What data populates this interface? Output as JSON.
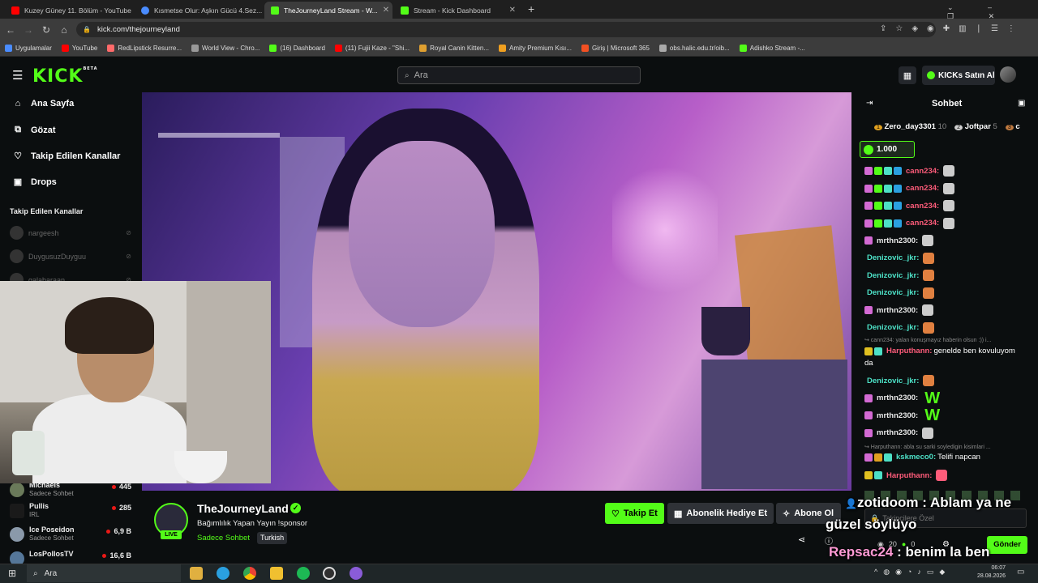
{
  "browser": {
    "tabs": [
      {
        "title": "Kuzey Güney 11. Bölüm - YouTube",
        "color": "#ff0000",
        "active": false
      },
      {
        "title": "Kısmetse Olur: Aşkın Gücü 4.Sez...",
        "color": "#4a8cff",
        "active": false
      },
      {
        "title": "TheJourneyLand Stream - W...",
        "color": "#53fc18",
        "active": true
      },
      {
        "title": "Stream - Kick Dashboard",
        "color": "#53fc18",
        "active": false
      }
    ],
    "new_tab": "+",
    "url": "kick.com/thejourneyland",
    "bookmarks": [
      {
        "label": "Uygulamalar",
        "color": "#4a8cff"
      },
      {
        "label": "YouTube",
        "color": "#ff0000"
      },
      {
        "label": "RedLipstick Resurre...",
        "color": "#ff6a6a"
      },
      {
        "label": "World View - Chro...",
        "color": "#999999"
      },
      {
        "label": "(16) Dashboard",
        "color": "#53fc18"
      },
      {
        "label": "(11) Fujii Kaze - \"Shi...",
        "color": "#ff0000"
      },
      {
        "label": "Royal Canin Kitten...",
        "color": "#e0a030"
      },
      {
        "label": "Amity Premium Kısı...",
        "color": "#f0a020"
      },
      {
        "label": "Giriş | Microsoft 365",
        "color": "#f25022"
      },
      {
        "label": "obs.halic.edu.tr/oib...",
        "color": "#aaaaaa"
      },
      {
        "label": "Adishko Stream -...",
        "color": "#53fc18"
      }
    ]
  },
  "header": {
    "logo": "KICK",
    "logo_sup": "BETA",
    "search_placeholder": "Ara",
    "kicks_button": "KICKs Satın Al",
    "accent": "#53fc18"
  },
  "sidebar": {
    "nav": [
      "Ana Sayfa",
      "Gözat",
      "Takip Edilen Kanallar",
      "Drops"
    ],
    "followed_header": "Takip Edilen Kanallar",
    "followed": [
      "nargeesh",
      "DuygusuzDuyguu",
      "galabaraan"
    ],
    "recommended": [
      {
        "name": "Michaels",
        "category": "Sadece Sohbet",
        "viewers": "445"
      },
      {
        "name": "Pullis",
        "category": "IRL",
        "viewers": "285"
      },
      {
        "name": "Ice Poseidon",
        "category": "Sadece Sohbet",
        "viewers": "6,9 B"
      },
      {
        "name": "LosPollosTV",
        "category": "",
        "viewers": "16,6 B"
      }
    ]
  },
  "channel": {
    "name": "TheJourneyLand",
    "verified": "✓",
    "live": "LIVE",
    "title": "Bağımlılık Yapan Yayın !sponsor",
    "category": "Sadece Sohbet",
    "language": "Turkish",
    "follow": "Takip Et",
    "gift_sub": "Abonelik Hediye Et",
    "subscribe": "Abone Ol"
  },
  "chat": {
    "title": "Sohbet",
    "leaderboard": [
      {
        "rank": "1",
        "name": "Zero_day3301",
        "score": "10"
      },
      {
        "rank": "2",
        "name": "Joftpar",
        "score": "5"
      },
      {
        "rank": "3",
        "name": "c",
        "score": ""
      }
    ],
    "pinned_amount": "1.000",
    "messages": [
      {
        "user": "cann234:",
        "color": "#ff5c7a",
        "text": ""
      },
      {
        "user": "cann234:",
        "color": "#ff5c7a",
        "text": ""
      },
      {
        "user": "cann234:",
        "color": "#ff5c7a",
        "text": ""
      },
      {
        "user": "cann234:",
        "color": "#ff5c7a",
        "text": ""
      },
      {
        "user": "mrthn2300:",
        "color": "#e8e8e8",
        "text": ""
      },
      {
        "user": "Denizovic_jkr:",
        "color": "#4de0c6",
        "text": ""
      },
      {
        "user": "Denizovic_jkr:",
        "color": "#4de0c6",
        "text": ""
      },
      {
        "user": "Denizovic_jkr:",
        "color": "#4de0c6",
        "text": ""
      },
      {
        "user": "mrthn2300:",
        "color": "#e8e8e8",
        "text": ""
      },
      {
        "user": "Denizovic_jkr:",
        "color": "#4de0c6",
        "text": ""
      }
    ],
    "reply1": "↪ cann234: yalan konuşmayız haberin olsun :)) i...",
    "harputhann_user": "Harputhann:",
    "harputhann_text": "genelde ben kovuluyom",
    "harputhann_text2": "da",
    "messages2": [
      {
        "user": "Denizovic_jkr:",
        "color": "#4de0c6",
        "text": ""
      },
      {
        "user": "mrthn2300:",
        "color": "#e8e8e8",
        "text": "W"
      },
      {
        "user": "mrthn2300:",
        "color": "#e8e8e8",
        "text": "W"
      },
      {
        "user": "mrthn2300:",
        "color": "#e8e8e8",
        "text": ""
      }
    ],
    "reply2": "↪ Harputhann: abla su sarki soyledigin kisimlari ...",
    "ksk_user": "kskmeco0:",
    "ksk_text": "Telifi napcan",
    "harp2_user": "Harputhann:",
    "input_placeholder": "Takipçilere Özel",
    "count1": "20",
    "count2": "0",
    "send": "Gönder"
  },
  "overlay": {
    "line1_user": "zotidoom",
    "line1_text": " : Ablam ya ne",
    "line2_text": "güzel söylüyo",
    "line3_user": "Repsac24",
    "line3_text": " : benim la ben"
  },
  "taskbar": {
    "search": "Ara",
    "time": "06:07",
    "date": "28.08.2026"
  }
}
